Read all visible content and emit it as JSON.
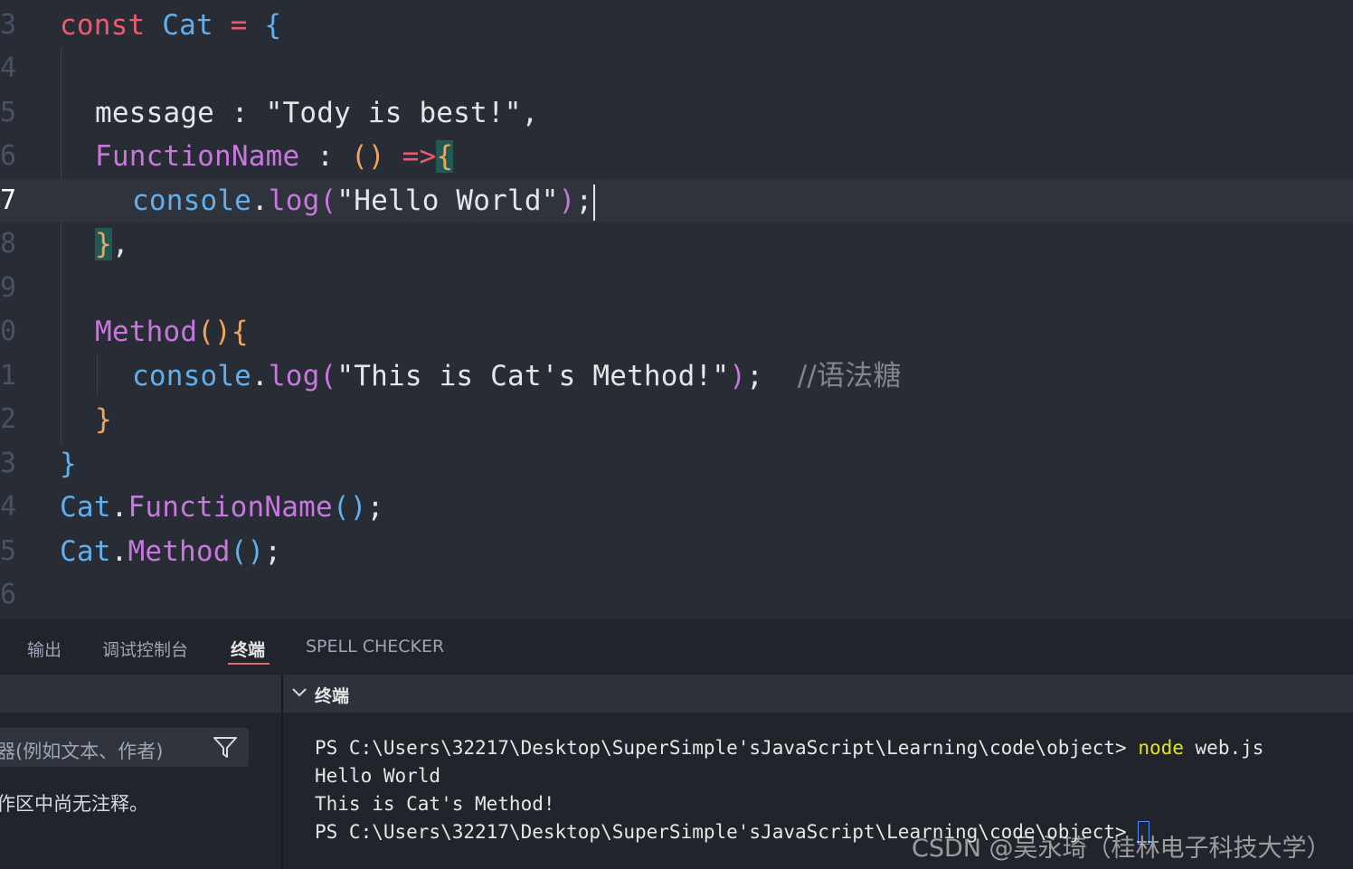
{
  "editor": {
    "line_numbers": [
      "3",
      "4",
      "5",
      "6",
      "7",
      "8",
      "9",
      "0",
      "1",
      "2",
      "3",
      "4",
      "5",
      "6"
    ],
    "active_line_number": "7",
    "code": {
      "l3_kw": "const",
      "l3_name": "Cat",
      "l3_eq": "=",
      "l3_brace": "{",
      "l5_key": "message",
      "l5_colon": ":",
      "l5_str": "\"Tody is best!\",",
      "l6_key": "FunctionName",
      "l6_colon": ":",
      "l6_parens": "()",
      "l6_arrow": "=>",
      "l6_brace": "{",
      "l7_obj": "console",
      "l7_dot": ".",
      "l7_fn": "log",
      "l7_open": "(",
      "l7_str": "\"Hello World\"",
      "l7_close": ")",
      "l7_semi": ";",
      "l8_brace": "}",
      "l8_comma": ",",
      "l10_fn": "Method",
      "l10_parens": "()",
      "l10_brace": "{",
      "l11_obj": "console",
      "l11_dot": ".",
      "l11_fn": "log",
      "l11_open": "(",
      "l11_str": "\"This is Cat's Method!\"",
      "l11_close": ")",
      "l11_semi": ";",
      "l11_comment": "//语法糖",
      "l12_brace": "}",
      "l13_brace": "}",
      "l14_obj": "Cat",
      "l14_dot": ".",
      "l14_fn": "FunctionName",
      "l14_parens": "()",
      "l14_semi": ";",
      "l15_obj": "Cat",
      "l15_dot": ".",
      "l15_fn": "Method",
      "l15_parens": "()",
      "l15_semi": ";"
    }
  },
  "panel": {
    "tabs": [
      {
        "label": "输出"
      },
      {
        "label": "调试控制台"
      },
      {
        "label": "终端",
        "active": true
      },
      {
        "label": "SPELL CHECKER"
      }
    ],
    "comments": {
      "filter_placeholder": "器(例如文本、作者)",
      "empty_message": "作区中尚无注释。"
    },
    "terminal": {
      "title": "终端",
      "lines": [
        {
          "prefix": "PS C:\\Users\\32217\\Desktop\\SuperSimple'sJavaScript\\Learning\\code\\object> ",
          "cmd": "node",
          "args": " web.js"
        },
        {
          "text": "Hello World"
        },
        {
          "text": "This is Cat's Method!"
        },
        {
          "prompt": "PS C:\\Users\\32217\\Desktop\\SuperSimple'sJavaScript\\Learning\\code\\object> "
        }
      ]
    }
  },
  "watermark": "CSDN @吴永琦（桂林电子科技大学）",
  "colors": {
    "editor_bg": "#282c34",
    "panel_bg": "#21252b",
    "keyword": "#ef596f",
    "function": "#c678dd",
    "object": "#61afef",
    "terminal_cmd": "#e5e510",
    "tab_underline": "#e06c75"
  }
}
